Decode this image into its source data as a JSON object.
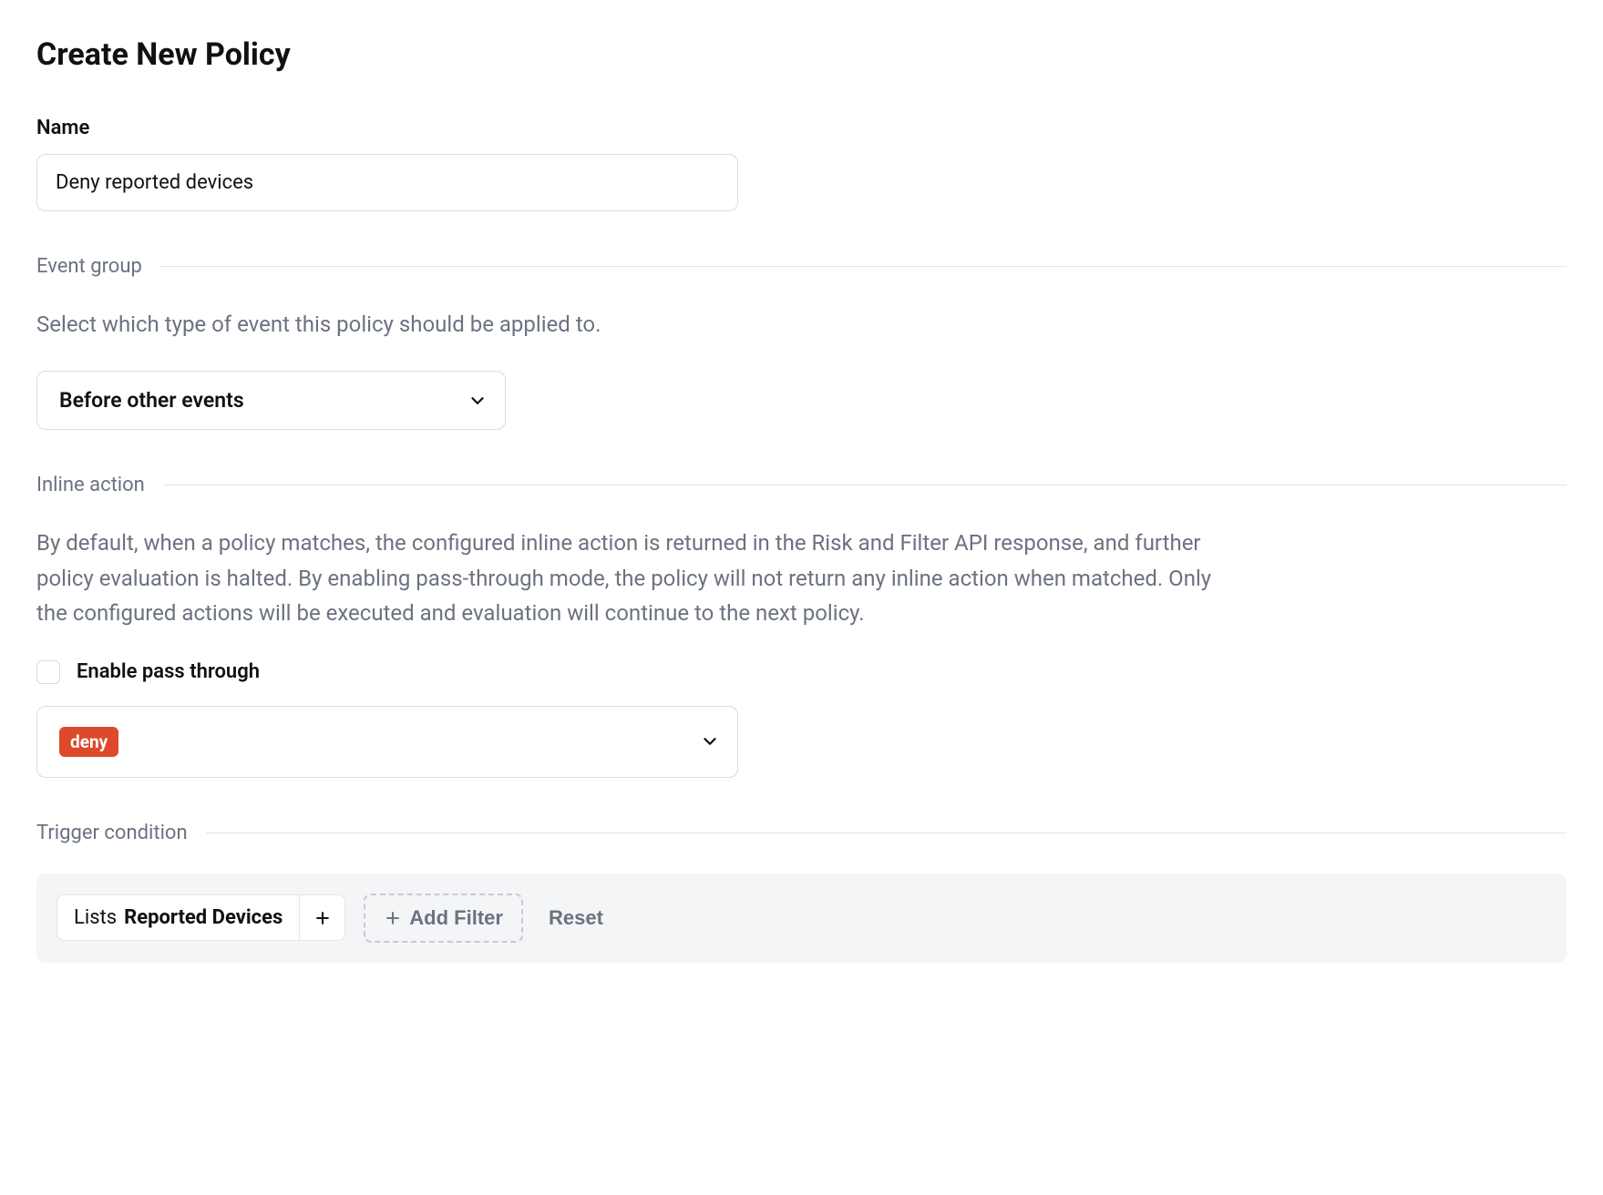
{
  "page": {
    "title": "Create New Policy"
  },
  "name_field": {
    "label": "Name",
    "value": "Deny reported devices"
  },
  "event_group": {
    "section_label": "Event group",
    "description": "Select which type of event this policy should be applied to.",
    "selected": "Before other events"
  },
  "inline_action": {
    "section_label": "Inline action",
    "description": "By default, when a policy matches, the configured inline action is returned in the Risk and Filter API response, and further policy evaluation is halted. By enabling pass-through mode, the policy will not return any inline action when matched. Only the configured actions will be executed and evaluation will continue to the next policy.",
    "pass_through_label": "Enable pass through",
    "pass_through_checked": false,
    "selected_action": "deny"
  },
  "trigger_condition": {
    "section_label": "Trigger condition",
    "filter": {
      "prefix": "Lists",
      "value": "Reported Devices"
    },
    "add_filter_label": "Add Filter",
    "reset_label": "Reset"
  }
}
